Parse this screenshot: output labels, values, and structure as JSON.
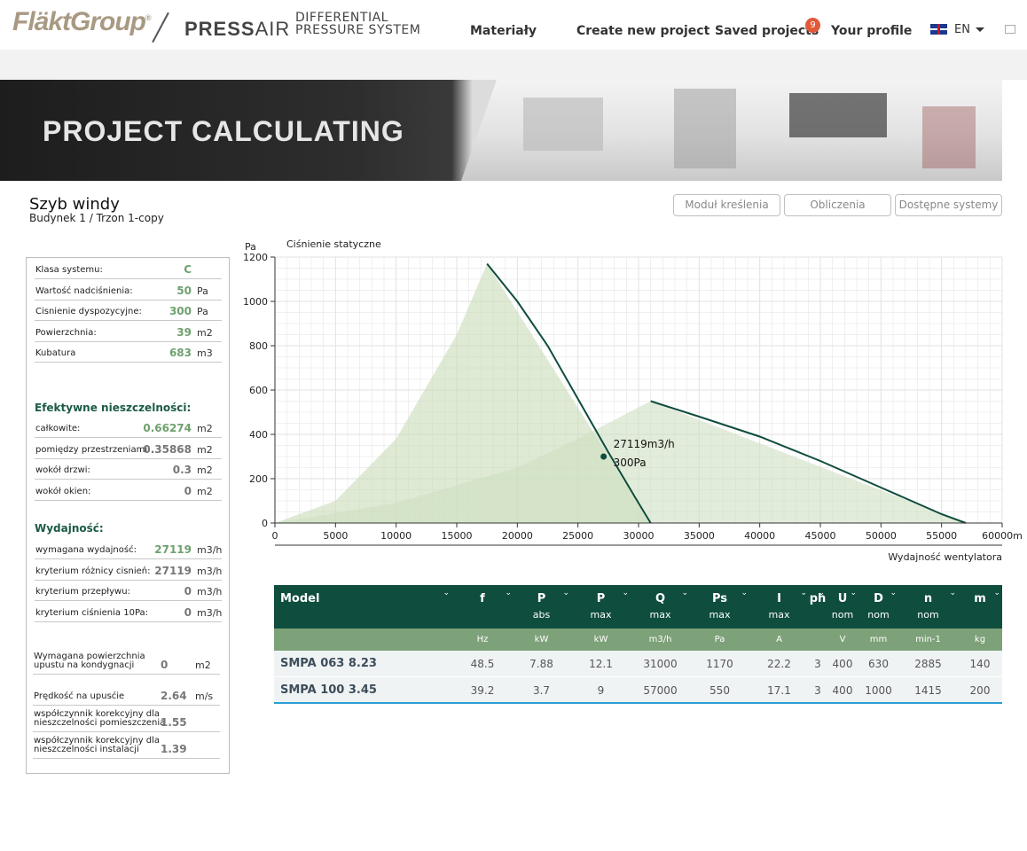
{
  "header": {
    "logo": "FläktGroup",
    "product_bold": "PRESS",
    "product_light": "AIR",
    "subtitle_line1": "DIFFERENTIAL",
    "subtitle_line2": "PRESSURE SYSTEM",
    "nav": [
      "Materiały",
      "Create new project",
      "Saved projects",
      "Your profile"
    ],
    "saved_count": "9",
    "language": "EN"
  },
  "banner": {
    "title": "PROJECT CALCULATING"
  },
  "page": {
    "title": "Szyb windy",
    "breadcrumb": "Budynek 1  /  Trzon 1-copy",
    "buttons": [
      "Moduł kreślenia",
      "Obliczenia",
      "Dostępne systemy"
    ]
  },
  "panel": {
    "system": [
      {
        "label": "Klasa systemu:",
        "value": "C",
        "unit": ""
      },
      {
        "label": "Wartość nadciśnienia:",
        "value": "50",
        "unit": "Pa"
      },
      {
        "label": "Cisnienie dyspozycyjne:",
        "value": "300",
        "unit": "Pa"
      },
      {
        "label": "Powierzchnia:",
        "value": "39",
        "unit": "m2"
      },
      {
        "label": "Kubatura",
        "value": "683",
        "unit": "m3"
      }
    ],
    "leak_title": "Efektywne nieszczelności:",
    "leak": [
      {
        "label": "całkowite:",
        "value": "0.66274",
        "unit": "m2"
      },
      {
        "label": "pomiędzy przestrzeniami:",
        "value": "0.35868",
        "unit": "m2"
      },
      {
        "label": "wokół drzwi:",
        "value": "0.3",
        "unit": "m2"
      },
      {
        "label": "wokół okien:",
        "value": "0",
        "unit": "m2"
      }
    ],
    "perf_title": "Wydajność:",
    "perf": [
      {
        "label": "wymagana wydajność:",
        "value": "27119",
        "unit": "m3/h"
      },
      {
        "label": "kryterium różnicy cisnień:",
        "value": "27119",
        "unit": "m3/h"
      },
      {
        "label": "kryterium przepływu:",
        "value": "0",
        "unit": "m3/h"
      },
      {
        "label": " kryterium ciśnienia 10Pa:",
        "value": "0",
        "unit": "m3/h"
      }
    ],
    "extra": [
      {
        "label1": "Wymagana powierzchnia",
        "label2": "upustu na kondygnacji",
        "value": "0",
        "unit": "m2"
      },
      {
        "label1": "Prędkość na upusćie",
        "label2": "",
        "value": "2.64",
        "unit": "m/s"
      },
      {
        "label1": "współczynnik korekcyjny dla",
        "label2": "nieszczelności pomieszczenia",
        "value": "1.55",
        "unit": ""
      },
      {
        "label1": "współczynnik korekcyjny dla",
        "label2": "nieszczelności instalacji",
        "value": "1.39",
        "unit": ""
      }
    ]
  },
  "chart_data": {
    "type": "area",
    "title": "Ciśnienie statyczne",
    "ylabel": "Pa",
    "xlabel": "Wydajność wentylatora",
    "xlim": [
      0,
      60000
    ],
    "ylim": [
      0,
      1200
    ],
    "xticks": [
      "0",
      "5000",
      "10000",
      "15000",
      "20000",
      "25000",
      "30000",
      "35000",
      "40000",
      "45000",
      "50000",
      "55000",
      "60000m"
    ],
    "yticks": [
      "0",
      "200",
      "400",
      "600",
      "800",
      "1000",
      "1200"
    ],
    "series": [
      {
        "x": [
          17500,
          20000,
          22500,
          25000,
          27500,
          30000,
          31000
        ],
        "y": [
          1170,
          1000,
          800,
          560,
          320,
          90,
          0
        ]
      },
      {
        "x": [
          31000,
          35000,
          40000,
          45000,
          50000,
          55000,
          57000
        ],
        "y": [
          550,
          480,
          390,
          280,
          160,
          40,
          0
        ]
      }
    ],
    "envelopes": [
      {
        "x": [
          0,
          5000,
          10000,
          15000,
          17500,
          31000
        ],
        "y": [
          0,
          100,
          380,
          850,
          1170,
          0
        ]
      },
      {
        "x": [
          0,
          10000,
          20000,
          25000,
          31000,
          57000
        ],
        "y": [
          0,
          90,
          250,
          380,
          550,
          0
        ]
      }
    ],
    "operating_point": {
      "x": 27119,
      "y": 300,
      "label1": "27119m3/h",
      "label2": "300Pa"
    },
    "colors": {
      "curve": "#0f4d3e",
      "fill1": "#c8dcb8",
      "fill2": "#cfe0c2",
      "grid": "#e2e2e2"
    }
  },
  "table": {
    "headers": [
      {
        "h1": "Model",
        "h2": ""
      },
      {
        "h1": "f",
        "h2": ""
      },
      {
        "h1": "P",
        "h2": "abs"
      },
      {
        "h1": "P",
        "h2": "max"
      },
      {
        "h1": "Q",
        "h2": "max"
      },
      {
        "h1": "Ps",
        "h2": "max"
      },
      {
        "h1": "I",
        "h2": "max"
      },
      {
        "h1": "ph",
        "h2": ""
      },
      {
        "h1": "U",
        "h2": "nom"
      },
      {
        "h1": "D",
        "h2": "nom"
      },
      {
        "h1": "n",
        "h2": "nom"
      },
      {
        "h1": "m",
        "h2": ""
      }
    ],
    "units": [
      "",
      "Hz",
      "kW",
      "kW",
      "m3/h",
      "Pa",
      "A",
      "",
      "V",
      "mm",
      "min-1",
      "kg"
    ],
    "rows": [
      [
        "SMPA 063 8.23",
        "48.5",
        "7.88",
        "12.1",
        "31000",
        "1170",
        "22.2",
        "3",
        "400",
        "630",
        "2885",
        "140"
      ],
      [
        "SMPA 100 3.45",
        "39.2",
        "3.7",
        "9",
        "57000",
        "550",
        "17.1",
        "3",
        "400",
        "1000",
        "1415",
        "200"
      ]
    ]
  }
}
